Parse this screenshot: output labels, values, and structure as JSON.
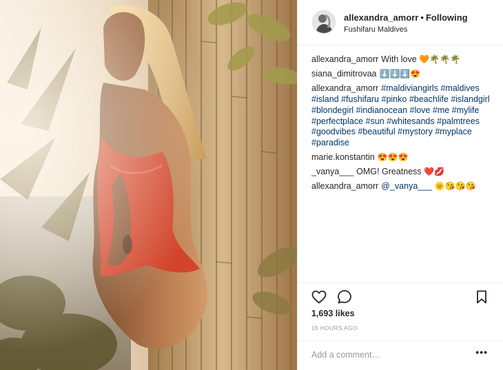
{
  "post": {
    "image_alt": "Photo of a woman in a red swimsuit leaning against a bamboo wall on a beach at sunset"
  },
  "header": {
    "username": "allexandra_amorr",
    "separator": "•",
    "follow_label": "Following",
    "location": "Fushifaru Maldives",
    "avatar_icon": "profile-avatar-icon"
  },
  "comments": [
    {
      "user": "allexandra_amorr",
      "parts": [
        {
          "t": "text",
          "v": "With love "
        }
      ],
      "emoji": "🧡🌴🌴🌴"
    },
    {
      "user": "siana_dimitrovaa",
      "parts": [],
      "emoji": "⬇️⬇️⬇️😍"
    },
    {
      "user": "allexandra_amorr",
      "parts": [
        {
          "t": "tag",
          "v": "#maldiviangirls"
        },
        {
          "t": "tag",
          "v": "#maldives"
        },
        {
          "t": "tag",
          "v": "#island"
        },
        {
          "t": "tag",
          "v": "#fushifaru"
        },
        {
          "t": "tag",
          "v": "#pinko"
        },
        {
          "t": "tag",
          "v": "#beachlife"
        },
        {
          "t": "tag",
          "v": "#islandgirl"
        },
        {
          "t": "tag",
          "v": "#blondegirl"
        },
        {
          "t": "tag",
          "v": "#indianocean"
        },
        {
          "t": "tag",
          "v": "#love"
        },
        {
          "t": "tag",
          "v": "#me"
        },
        {
          "t": "tag",
          "v": "#mylife"
        },
        {
          "t": "tag",
          "v": "#perfectplace"
        },
        {
          "t": "tag",
          "v": "#sun"
        },
        {
          "t": "tag",
          "v": "#whitesands"
        },
        {
          "t": "tag",
          "v": "#palmtrees"
        },
        {
          "t": "tag",
          "v": "#goodvibes"
        },
        {
          "t": "tag",
          "v": "#beautiful"
        },
        {
          "t": "tag",
          "v": "#mystory"
        },
        {
          "t": "tag",
          "v": "#myplace"
        },
        {
          "t": "tag",
          "v": "#paradise"
        }
      ],
      "emoji": ""
    },
    {
      "user": "marie.konstantin",
      "parts": [],
      "emoji": "😍😍😍"
    },
    {
      "user": "_vanya___",
      "parts": [
        {
          "t": "text",
          "v": "OMG! Greatness"
        }
      ],
      "emoji": "❤️💋"
    },
    {
      "user": "allexandra_amorr",
      "parts": [
        {
          "t": "tag",
          "v": "@_vanya___"
        }
      ],
      "emoji": "🌞😘😘😘"
    }
  ],
  "actions": {
    "like_icon": "heart-icon",
    "comment_icon": "comment-icon",
    "save_icon": "bookmark-icon"
  },
  "likes": "1,693 likes",
  "timestamp": "16 HOURS AGO",
  "comment_box": {
    "placeholder": "Add a comment…",
    "more_label": "•••"
  },
  "colors": {
    "hashtag": "#003569",
    "swimsuit": "#d2452c",
    "border": "#efefef"
  }
}
